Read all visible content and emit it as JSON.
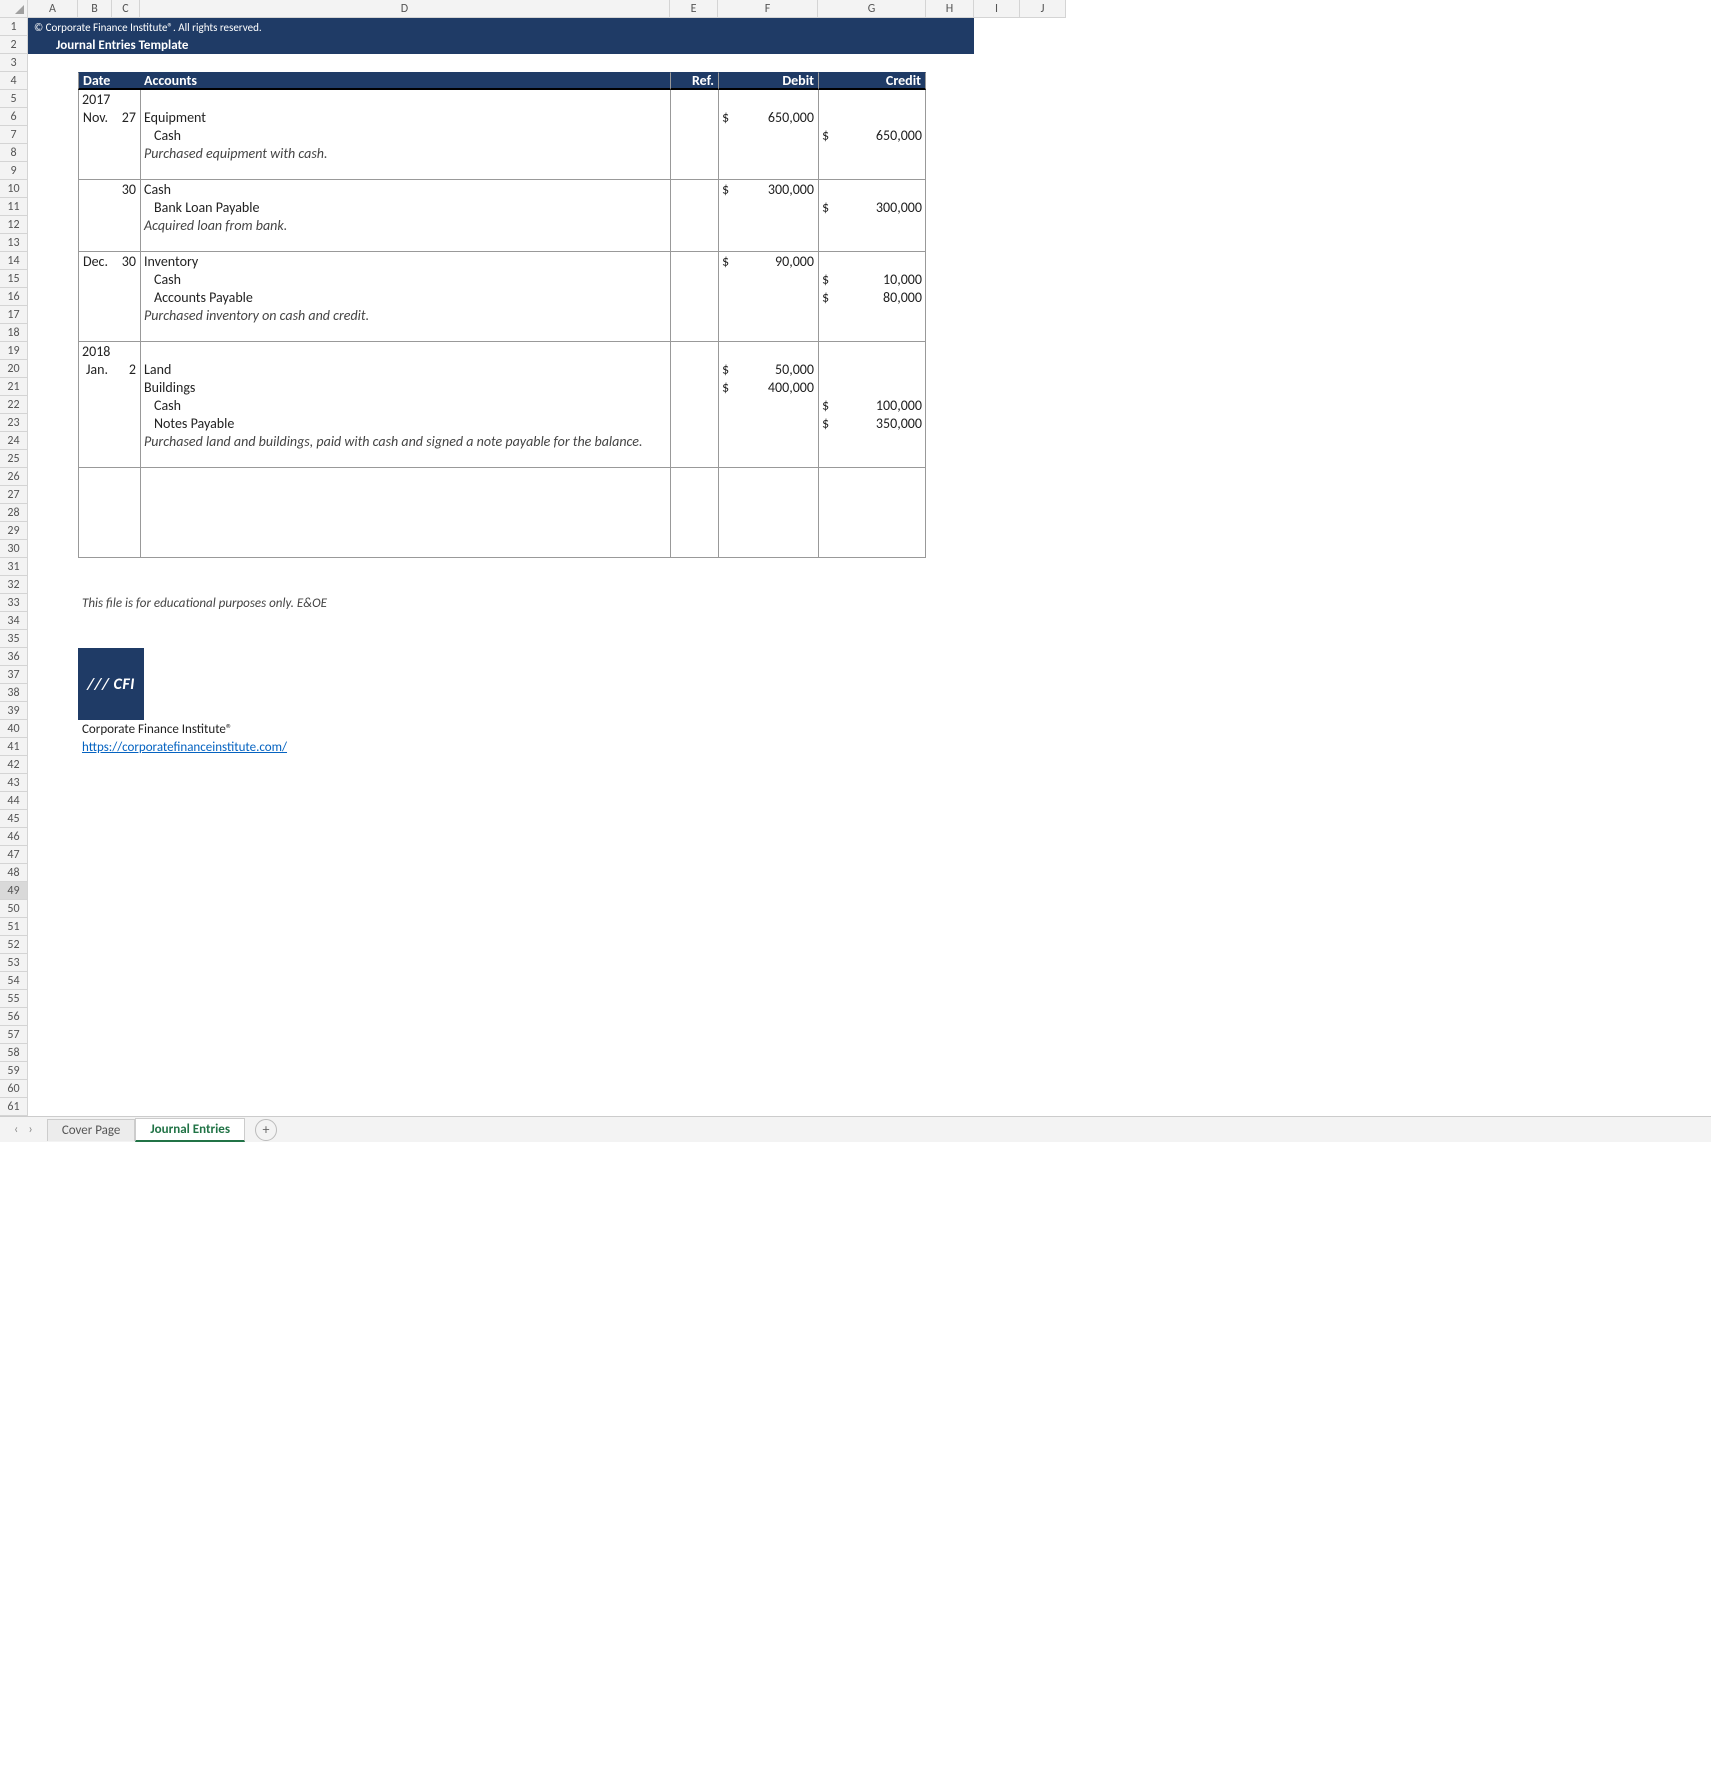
{
  "cols": [
    "A",
    "B",
    "C",
    "D",
    "E",
    "F",
    "G",
    "H",
    "I",
    "J"
  ],
  "rowCount": 61,
  "activeRow": 49,
  "copyright": "© Corporate Finance Institute®. All rights reserved.",
  "title": "Journal Entries Template",
  "headers": {
    "date": "Date",
    "accounts": "Accounts",
    "ref": "Ref.",
    "debit": "Debit",
    "credit": "Credit"
  },
  "years": {
    "y2017": "2017",
    "y2018": "2018"
  },
  "entries": {
    "e1": {
      "date_mon": "Nov.",
      "date_day": "27",
      "l1": "Equipment",
      "l2": "Cash",
      "desc": "Purchased equipment with cash.",
      "debit_sym": "$",
      "debit": "650,000",
      "credit_sym": "$",
      "credit": "650,000"
    },
    "e2": {
      "date_day": "30",
      "l1": "Cash",
      "l2": "Bank Loan Payable",
      "desc": "Acquired loan from bank.",
      "debit_sym": "$",
      "debit": "300,000",
      "credit_sym": "$",
      "credit": "300,000"
    },
    "e3": {
      "date_mon": "Dec.",
      "date_day": "30",
      "l1": "Inventory",
      "l2": "Cash",
      "l3": "Accounts Payable",
      "desc": "Purchased inventory on cash and credit.",
      "debit_sym": "$",
      "debit": "90,000",
      "credit1_sym": "$",
      "credit1": "10,000",
      "credit2_sym": "$",
      "credit2": "80,000"
    },
    "e4": {
      "date_mon": "Jan.",
      "date_day": "2",
      "l1": "Land",
      "l2": "Buildings",
      "l3": "Cash",
      "l4": "Notes Payable",
      "desc": "Purchased land and buildings, paid with cash and signed a note payable for the balance.",
      "d1_sym": "$",
      "d1": "50,000",
      "d2_sym": "$",
      "d2": "400,000",
      "c1_sym": "$",
      "c1": "100,000",
      "c2_sym": "$",
      "c2": "350,000"
    }
  },
  "disclaimer": "This file is for educational purposes only. E&OE",
  "logo_text": "/// CFI",
  "company": "Corporate Finance Institute®",
  "url": "https://corporatefinanceinstitute.com/",
  "tabs": {
    "t1": "Cover Page",
    "t2": "Journal Entries"
  },
  "nav": {
    "prev": "‹",
    "next": "›"
  },
  "add_tab": "+"
}
